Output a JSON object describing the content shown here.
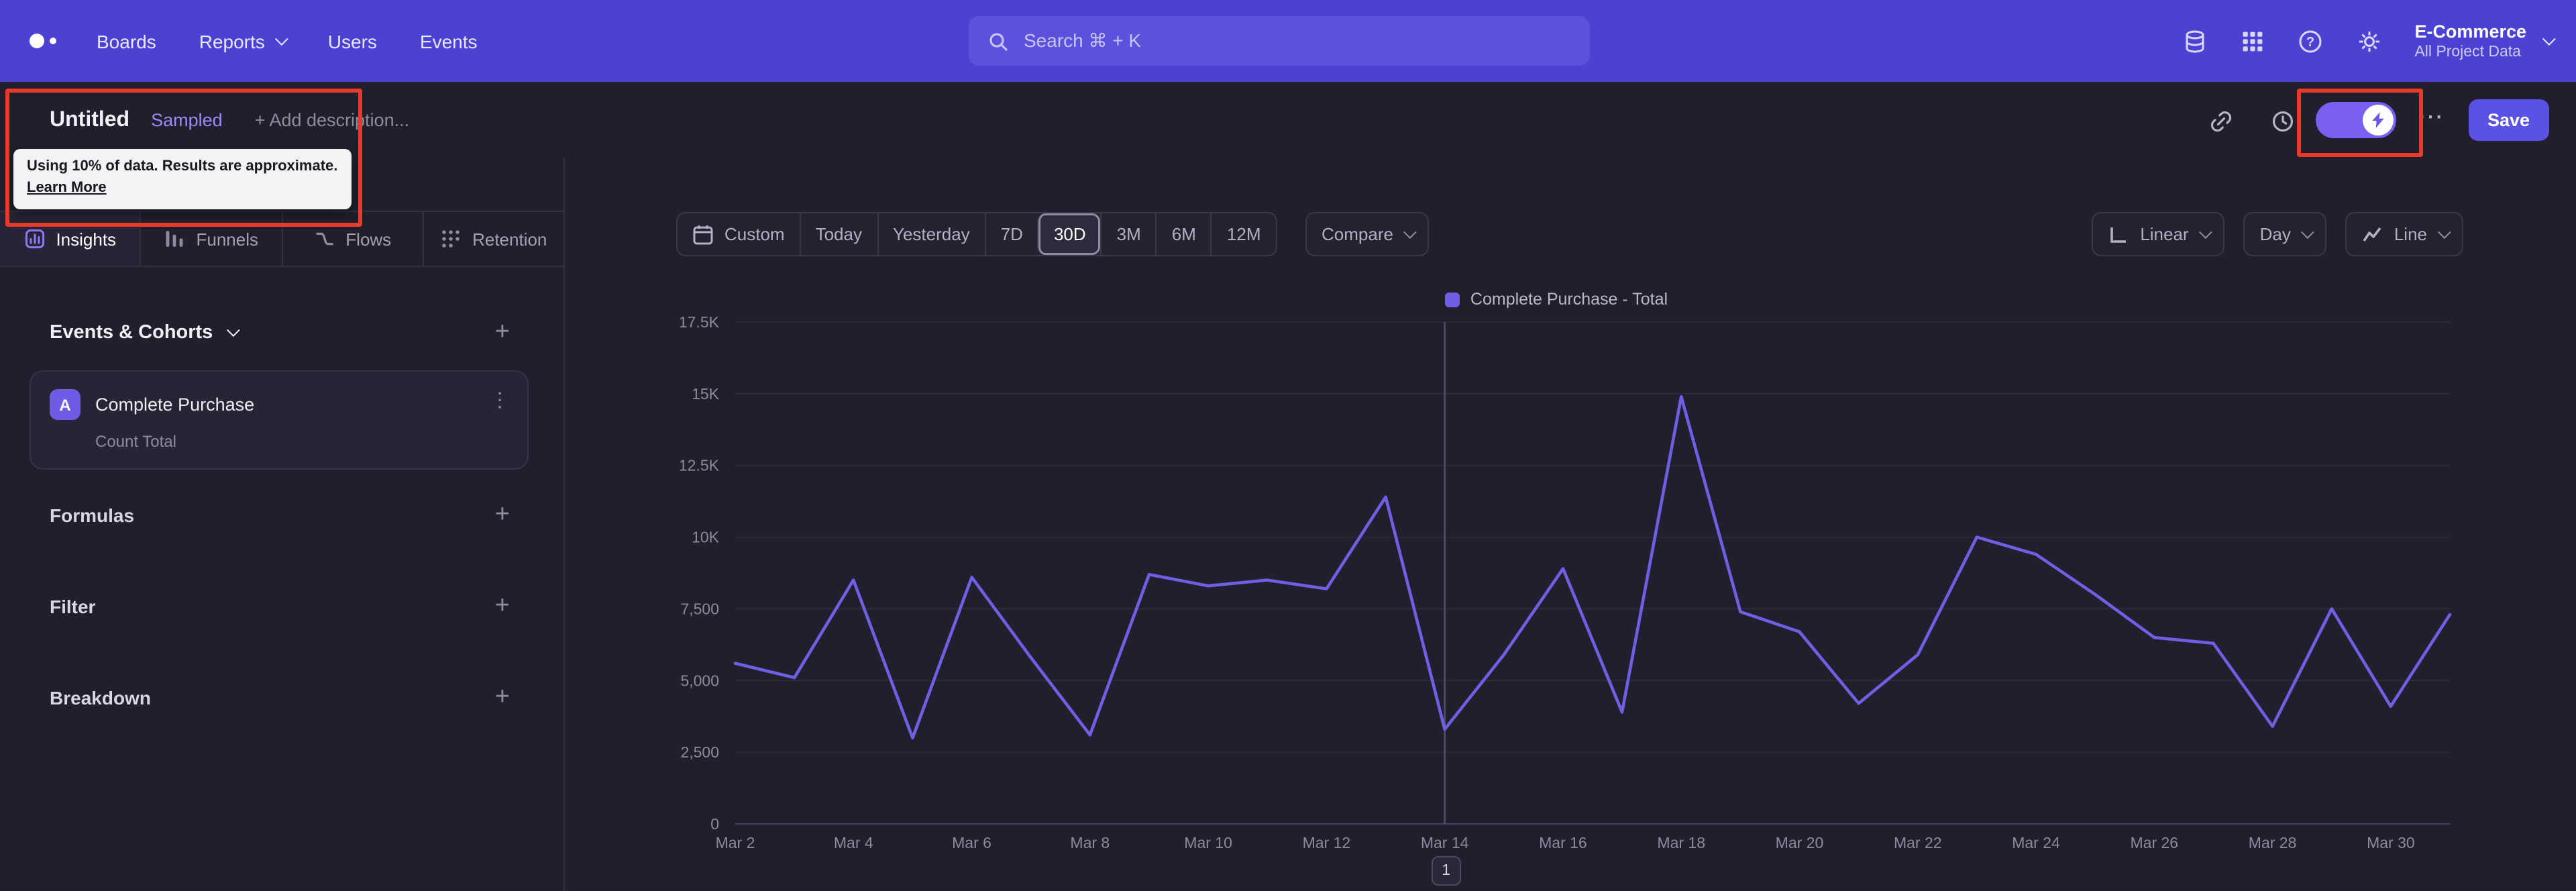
{
  "nav": {
    "items": [
      "Boards",
      "Reports",
      "Users",
      "Events"
    ],
    "search_placeholder": "Search  ⌘ + K",
    "project_name": "E-Commerce",
    "project_scope": "All Project Data"
  },
  "report_header": {
    "title": "Untitled",
    "sampled_badge": "Sampled",
    "add_description": "+ Add description...",
    "save_label": "Save",
    "tooltip_text": "Using 10% of data. Results are approximate.",
    "tooltip_link": "Learn More"
  },
  "sidebar": {
    "tabs": [
      {
        "label": "Insights"
      },
      {
        "label": "Funnels"
      },
      {
        "label": "Flows"
      },
      {
        "label": "Retention"
      }
    ],
    "active_tab": "Insights",
    "events_header": "Events & Cohorts",
    "event_card": {
      "badge": "A",
      "name": "Complete Purchase",
      "metric": "Count Total"
    },
    "sections": [
      {
        "label": "Formulas"
      },
      {
        "label": "Filter"
      },
      {
        "label": "Breakdown"
      }
    ]
  },
  "controls": {
    "custom_label": "Custom",
    "ranges": [
      "Today",
      "Yesterday",
      "7D",
      "30D",
      "3M",
      "6M",
      "12M"
    ],
    "active_range": "30D",
    "compare": "Compare",
    "scale": "Linear",
    "granularity": "Day",
    "chart_type": "Line"
  },
  "chart_data": {
    "type": "line",
    "title": "",
    "xlabel": "",
    "ylabel": "",
    "grid": true,
    "legend_position": "top-center",
    "x": [
      "Mar 2",
      "Mar 3",
      "Mar 4",
      "Mar 5",
      "Mar 6",
      "Mar 7",
      "Mar 8",
      "Mar 9",
      "Mar 10",
      "Mar 11",
      "Mar 12",
      "Mar 13",
      "Mar 14",
      "Mar 15",
      "Mar 16",
      "Mar 17",
      "Mar 18",
      "Mar 19",
      "Mar 20",
      "Mar 21",
      "Mar 22",
      "Mar 23",
      "Mar 24",
      "Mar 25",
      "Mar 26",
      "Mar 27",
      "Mar 28",
      "Mar 29",
      "Mar 30",
      "Mar 31"
    ],
    "xtick_every": 2,
    "series": [
      {
        "name": "Complete Purchase - Total",
        "color": "#6f5fe3",
        "values": [
          5600,
          5100,
          8500,
          3000,
          8600,
          5800,
          3100,
          8700,
          8300,
          8500,
          8200,
          11400,
          3300,
          5900,
          8900,
          3900,
          14900,
          7400,
          6700,
          4200,
          5900,
          10000,
          9400,
          8000,
          6500,
          6300,
          3400,
          7500,
          4100,
          7300
        ]
      }
    ],
    "ylim": [
      0,
      17500
    ],
    "yticks": [
      0,
      2500,
      5000,
      7500,
      10000,
      12500,
      15000,
      17500
    ],
    "ytick_labels": [
      "0",
      "2,500",
      "5,000",
      "7,500",
      "10K",
      "12.5K",
      "15K",
      "17.5K"
    ],
    "annotation": {
      "x": "Mar 14",
      "label": "1"
    }
  }
}
